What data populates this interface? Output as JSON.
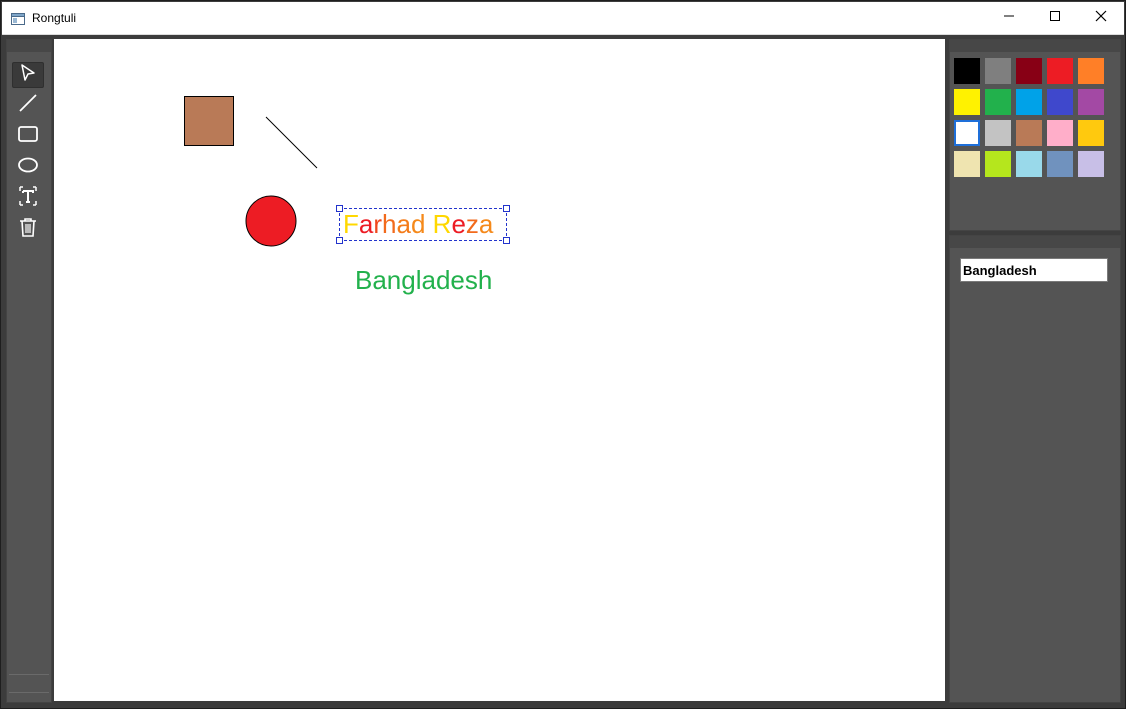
{
  "window": {
    "title": "Rongtuli",
    "minimize_icon": "minimize-icon",
    "maximize_icon": "maximize-icon",
    "close_icon": "close-icon"
  },
  "toolbar": {
    "tools": [
      {
        "name": "select",
        "icon": "pointer-icon",
        "selected": true
      },
      {
        "name": "line",
        "icon": "line-icon",
        "selected": false
      },
      {
        "name": "rectangle",
        "icon": "rectangle-icon",
        "selected": false
      },
      {
        "name": "ellipse",
        "icon": "ellipse-icon",
        "selected": false
      },
      {
        "name": "text",
        "icon": "text-tool-icon",
        "selected": false
      },
      {
        "name": "delete",
        "icon": "trash-icon",
        "selected": false
      }
    ]
  },
  "canvas": {
    "rectangle": {
      "fill": "#b97a57",
      "stroke": "#000000"
    },
    "line": {
      "stroke": "#000000"
    },
    "circle": {
      "fill": "#ed1c24",
      "stroke": "#000000"
    },
    "selected_text": {
      "value": "Farhad Reza",
      "letters": [
        {
          "char": "F",
          "color": "#ffd800"
        },
        {
          "char": "a",
          "color": "#ed1c24"
        },
        {
          "char": "r",
          "color": "#f0481e"
        },
        {
          "char": "h",
          "color": "#f26a1c"
        },
        {
          "char": "a",
          "color": "#f47c1a"
        },
        {
          "char": "d",
          "color": "#f5891a"
        },
        {
          "char": " ",
          "color": "#ffffff"
        },
        {
          "char": "R",
          "color": "#ffd800"
        },
        {
          "char": "e",
          "color": "#ed1c24"
        },
        {
          "char": "z",
          "color": "#f26a1c"
        },
        {
          "char": "a",
          "color": "#f5891a"
        }
      ]
    },
    "text_bangladesh": {
      "value": "Bangladesh",
      "color": "#22b14c"
    }
  },
  "palette": {
    "colors": [
      "#000000",
      "#7f7f7f",
      "#880015",
      "#ed1c24",
      "#ff7f27",
      "#fff200",
      "#22b14c",
      "#00a2e8",
      "#3f48cc",
      "#a349a4",
      "#ffffff",
      "#c3c3c3",
      "#b97a57",
      "#ffaec9",
      "#ffc90e",
      "#efe4b0",
      "#b5e61d",
      "#99d9ea",
      "#7092be",
      "#c8bfe7"
    ],
    "selected_index": 10
  },
  "text_panel": {
    "input_value": "Bangladesh"
  }
}
